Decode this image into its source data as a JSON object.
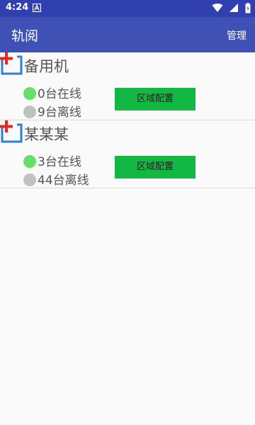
{
  "status_bar": {
    "time": "4:24",
    "notification_icon": "a-box-icon",
    "icons": [
      "wifi-icon",
      "cell-signal-icon",
      "battery-icon"
    ]
  },
  "app_bar": {
    "title": "轨阅",
    "action_label": "管理"
  },
  "groups": [
    {
      "name": "备用机",
      "online": "0台在线",
      "offline": "9台离线",
      "config_label": "区域配置"
    },
    {
      "name": "某某某",
      "online": "3台在线",
      "offline": "44台离线",
      "config_label": "区域配置"
    }
  ],
  "colors": {
    "status_bar": "#3040b0",
    "app_bar": "#3f51b5",
    "config_button": "#13b744",
    "online_dot": "#64e065",
    "offline_dot": "#bcc4bc",
    "add_icon_plus": "#e02a20",
    "add_icon_frame": "#2f7fd0"
  }
}
